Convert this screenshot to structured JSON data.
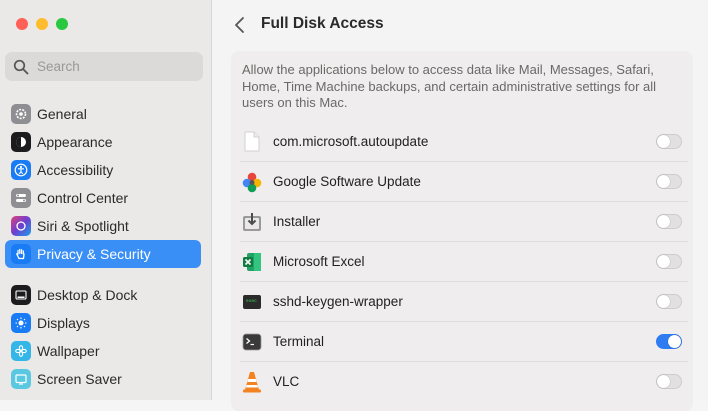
{
  "sidebar": {
    "search_placeholder": "Search",
    "items": [
      {
        "label": "General",
        "icon": "gear-icon",
        "color": "#8e8e93"
      },
      {
        "label": "Appearance",
        "icon": "appearance-icon",
        "color": "#1c1c1e"
      },
      {
        "label": "Accessibility",
        "icon": "accessibility-icon",
        "color": "#1a7cf5"
      },
      {
        "label": "Control Center",
        "icon": "control-center-icon",
        "color": "#8e8e93"
      },
      {
        "label": "Siri & Spotlight",
        "icon": "siri-icon",
        "color": "#6b3fd1"
      },
      {
        "label": "Privacy & Security",
        "icon": "hand-icon",
        "color": "#1a7cf5",
        "selected": true
      },
      {
        "label": "Desktop & Dock",
        "icon": "dock-icon",
        "color": "#1c1c1e"
      },
      {
        "label": "Displays",
        "icon": "displays-icon",
        "color": "#1a7cf5"
      },
      {
        "label": "Wallpaper",
        "icon": "wallpaper-icon",
        "color": "#35b6e8"
      },
      {
        "label": "Screen Saver",
        "icon": "screen-saver-icon",
        "color": "#5ac8e0"
      }
    ]
  },
  "main": {
    "title": "Full Disk Access",
    "description": "Allow the applications below to access data like Mail, Messages, Safari, Home, Time Machine backups, and certain administrative settings for all users on this Mac.",
    "apps": [
      {
        "name": "com.microsoft.autoupdate",
        "icon": "document-icon",
        "enabled": false
      },
      {
        "name": "Google Software Update",
        "icon": "google-update-icon",
        "enabled": false
      },
      {
        "name": "Installer",
        "icon": "installer-icon",
        "enabled": false
      },
      {
        "name": "Microsoft Excel",
        "icon": "excel-icon",
        "enabled": false
      },
      {
        "name": "sshd-keygen-wrapper",
        "icon": "terminal-exec-icon",
        "enabled": false
      },
      {
        "name": "Terminal",
        "icon": "terminal-icon",
        "enabled": true
      },
      {
        "name": "VLC",
        "icon": "vlc-icon",
        "enabled": false
      }
    ]
  },
  "colors": {
    "accent": "#3a8ff6",
    "toggle_on": "#2f7bf2"
  }
}
